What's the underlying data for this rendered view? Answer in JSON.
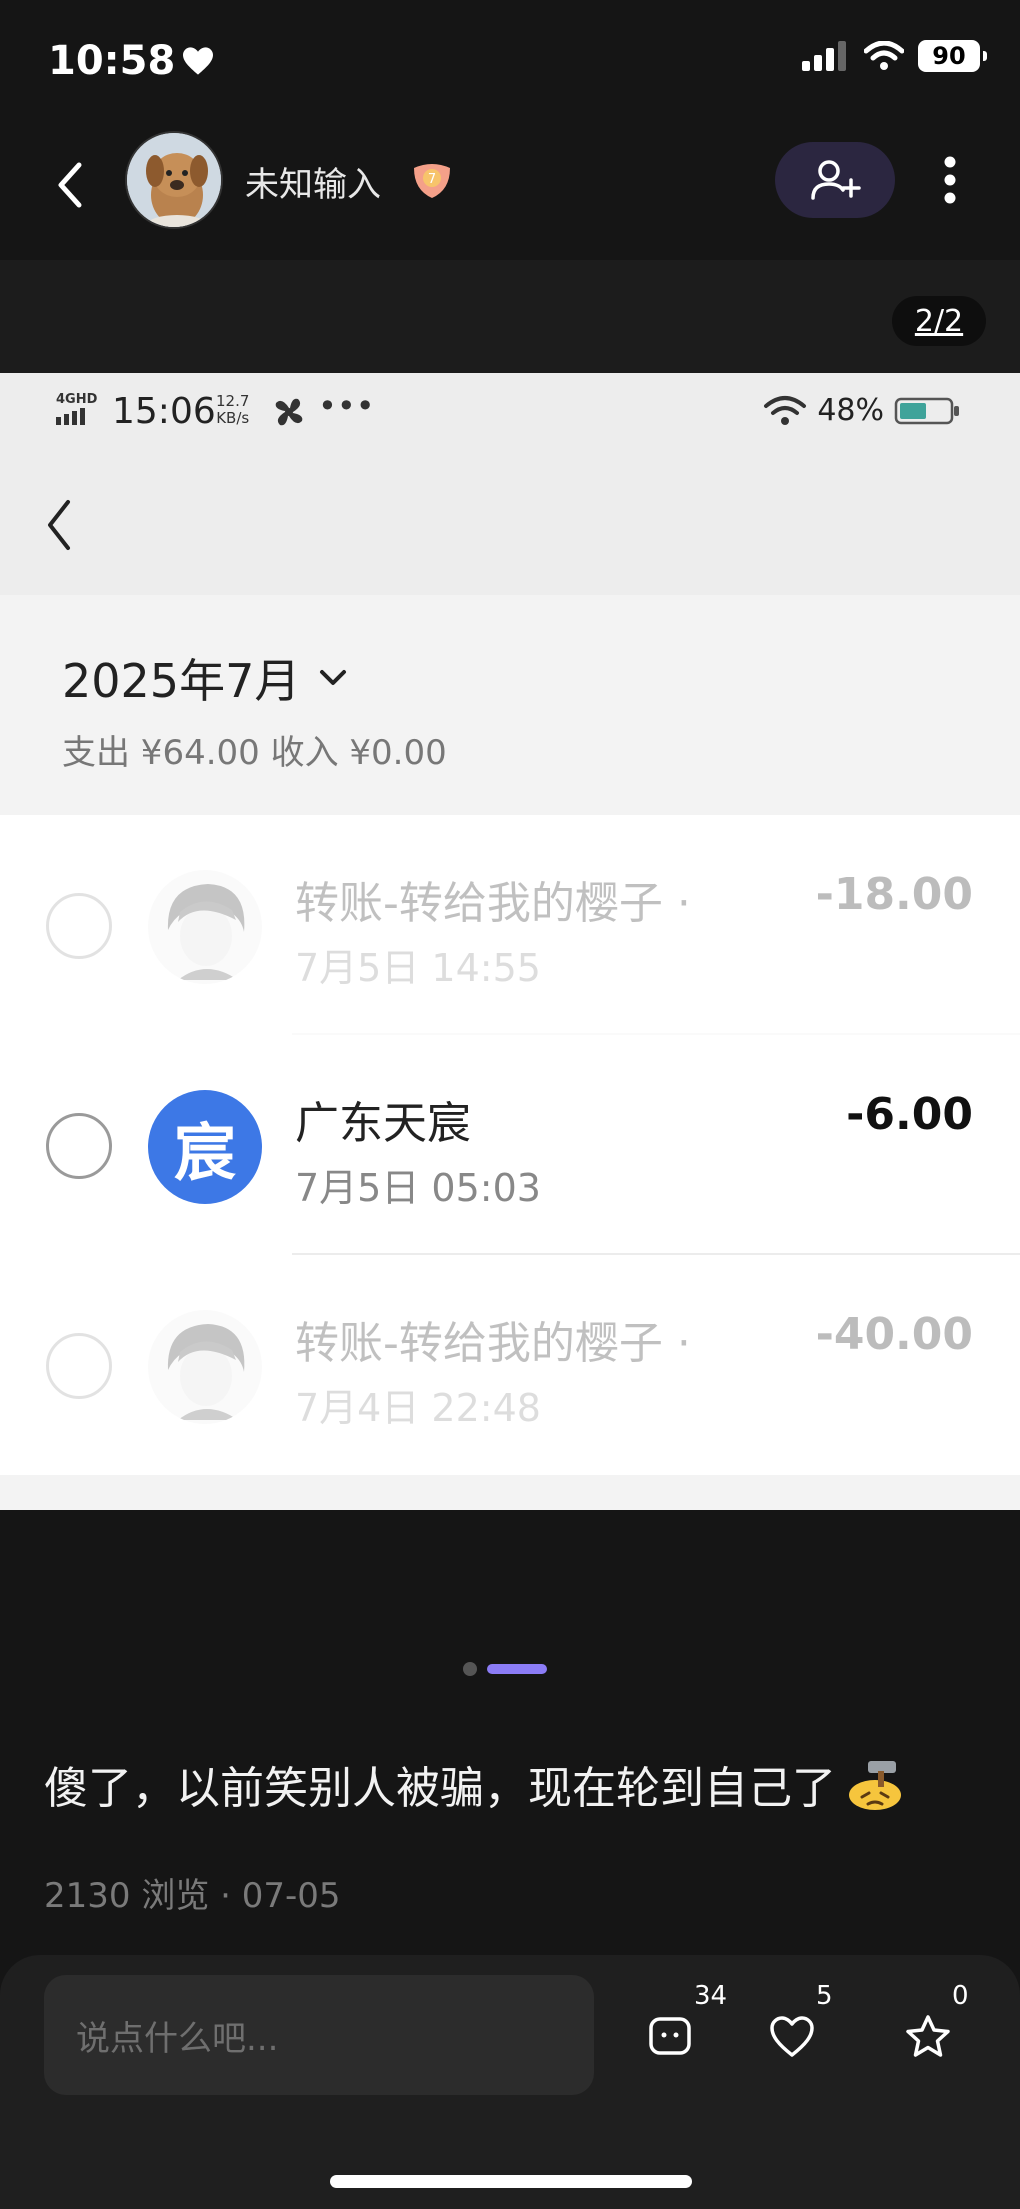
{
  "status_bar": {
    "time": "10:58",
    "battery": "90"
  },
  "nav": {
    "username": "未知输入",
    "badge_number": "7"
  },
  "image_viewer": {
    "page_indicator": "2/2"
  },
  "inner_screenshot": {
    "status": {
      "network": "4GHD",
      "time": "15:06",
      "speed_value": "12.7",
      "speed_unit": "KB/s",
      "dots": "•••",
      "battery": "48%"
    },
    "month": "2025年7月",
    "totals": "支出 ¥64.00 收入 ¥0.00",
    "transactions": [
      {
        "title": "转账-转给我的樱子 ·",
        "time": "7月5日 14:55",
        "amount": "-18.00"
      },
      {
        "title": "广东天宸",
        "time": "7月5日 05:03",
        "amount": "-6.00",
        "avatar_char": "宸"
      },
      {
        "title": "转账-转给我的樱子 ·",
        "time": "7月4日 22:48",
        "amount": "-40.00"
      }
    ]
  },
  "post": {
    "text": "傻了，以前笑别人被骗，现在轮到自己了",
    "meta": "2130 浏览 · 07-05"
  },
  "bottom": {
    "comment_placeholder": "说点什么吧...",
    "comments_count": "34",
    "likes_count": "5",
    "favorites_count": "0"
  },
  "colors": {
    "accent": "#8b7cf6",
    "follow_bg": "#2b2640",
    "char_avatar": "#3d78e6"
  }
}
